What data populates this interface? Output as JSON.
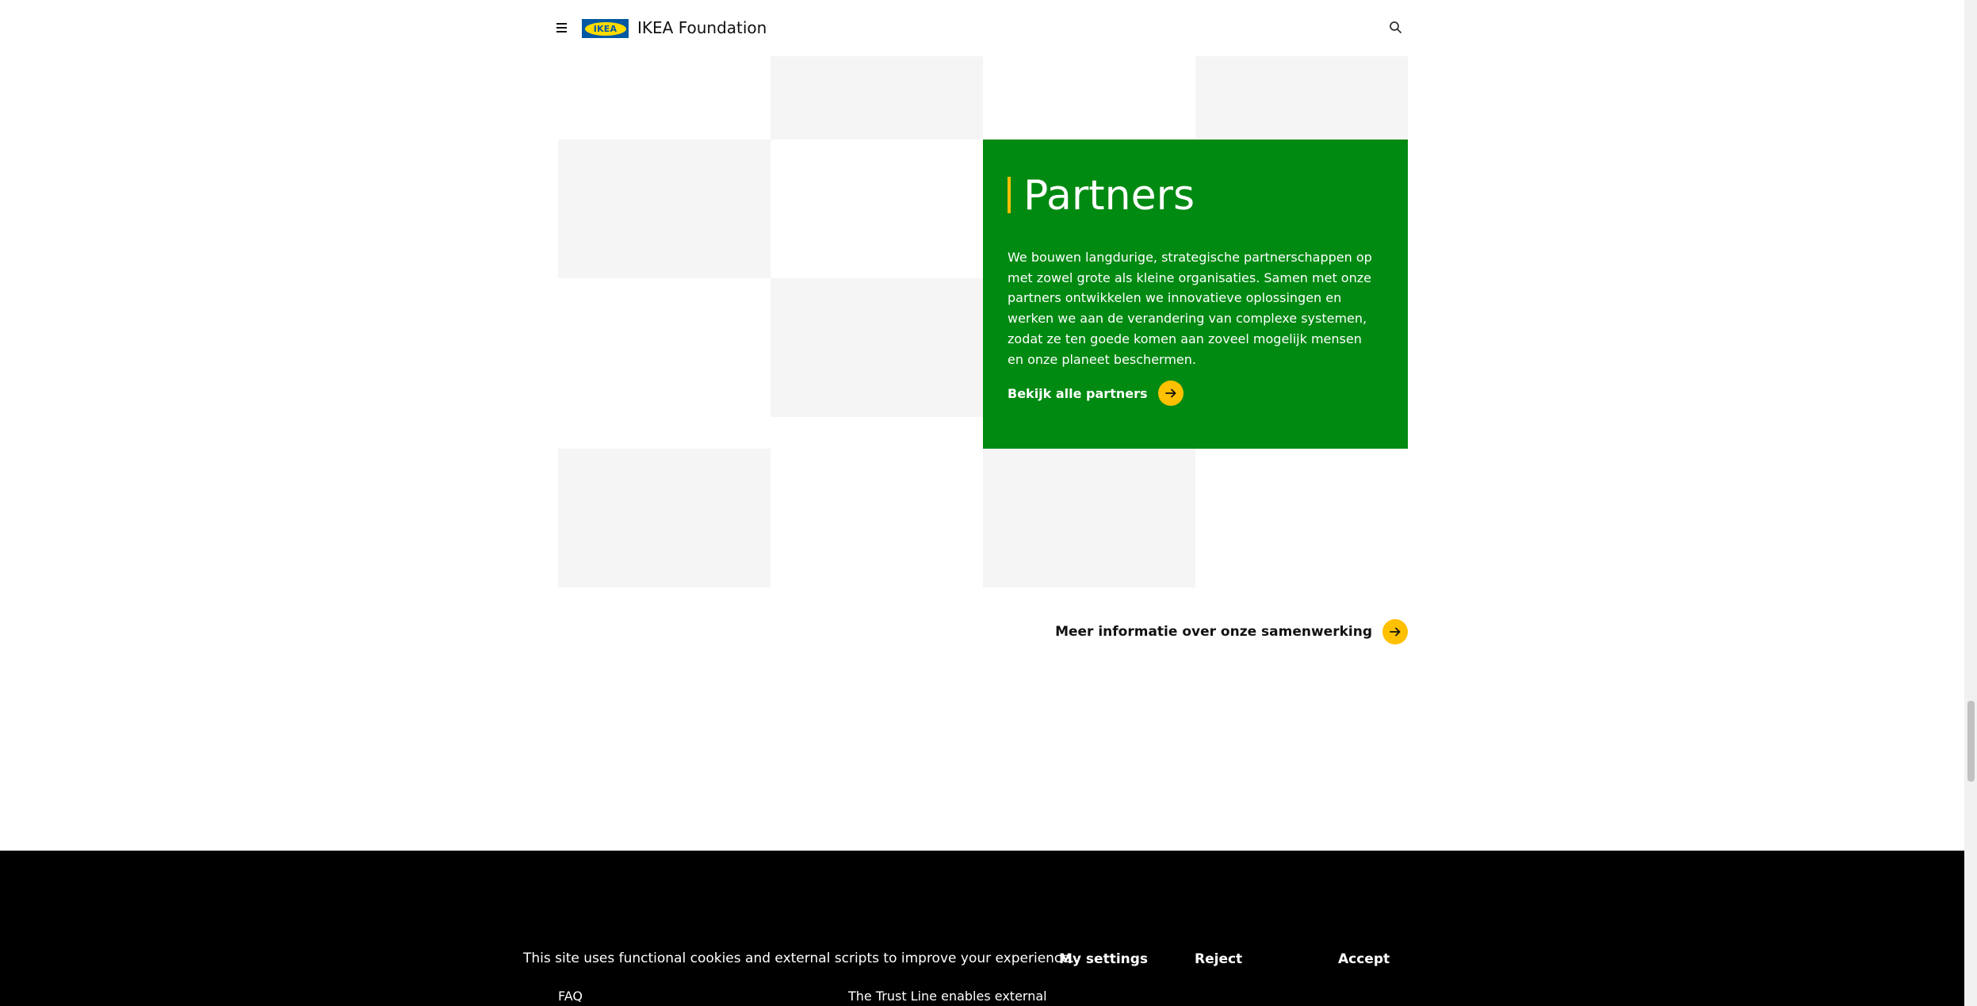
{
  "header": {
    "logo_text": "IKEA",
    "site_title": "IKEA Foundation",
    "menu_icon": "hamburger-menu-icon",
    "search_icon": "search-icon"
  },
  "partners_card": {
    "title": "Partners",
    "body": "We bouwen langdurige, strategische partnerschappen op met zowel grote als kleine organisaties. Samen met onze partners ontwikkelen we innovatieve oplossingen en werken we aan de verandering van complexe systemen, zodat ze ten goede komen aan zoveel mogelijk mensen en onze planeet beschermen.",
    "link_label": "Bekijk alle partners"
  },
  "more_link": {
    "label": "Meer informatie over onze samenwerking"
  },
  "footer": {
    "faq_label": "FAQ",
    "trust_line_text": "The Trust Line enables external"
  },
  "cookie_banner": {
    "message": "This site uses functional cookies and external scripts to improve your experience.",
    "settings_label": "My settings",
    "reject_label": "Reject",
    "accept_label": "Accept"
  },
  "colors": {
    "card_green": "#008a12",
    "accent_yellow": "#ffc000",
    "ikea_blue": "#0058a3",
    "ikea_yellow": "#ffdb00",
    "tile_grey": "#f5f5f5",
    "footer_black": "#000000"
  }
}
